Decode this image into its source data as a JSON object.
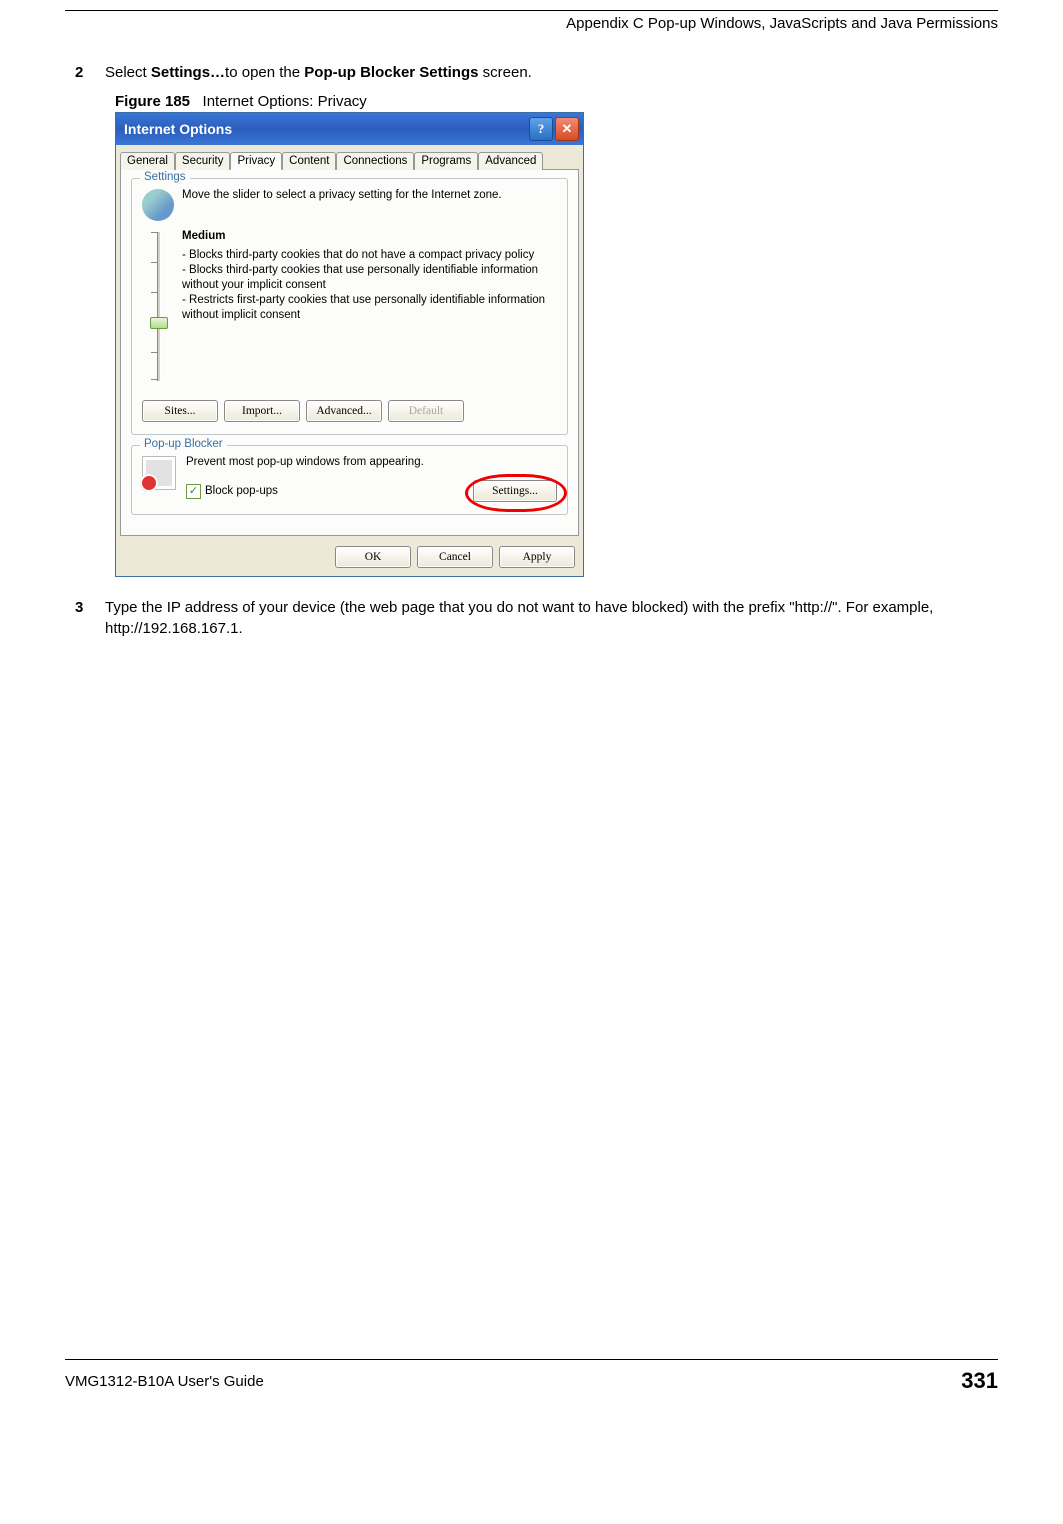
{
  "header": {
    "appendix_title": "Appendix C Pop-up Windows, JavaScripts and Java Permissions"
  },
  "steps": {
    "s2": {
      "num": "2",
      "pre": "Select ",
      "bold1": "Settings…",
      "mid": "to open the ",
      "bold2": "Pop-up Blocker Settings",
      "post": " screen."
    },
    "s3": {
      "num": "3",
      "text": "Type the IP address of your device (the web page that you do not want to have blocked) with the prefix \"http://\". For example, http://192.168.167.1."
    }
  },
  "figure": {
    "num": "Figure 185",
    "caption": "Internet Options: Privacy"
  },
  "dialog": {
    "title": "Internet Options",
    "help": "?",
    "close": "✕",
    "tabs": [
      "General",
      "Security",
      "Privacy",
      "Content",
      "Connections",
      "Programs",
      "Advanced"
    ],
    "active_tab_index": 2,
    "settings": {
      "group": "Settings",
      "desc": "Move the slider to select a privacy setting for the Internet zone.",
      "level": "Medium",
      "bullets": "- Blocks third-party cookies that do not have a compact privacy policy\n- Blocks third-party cookies that use personally identifiable information without your implicit consent\n- Restricts first-party cookies that use personally identifiable information without implicit consent",
      "buttons": {
        "sites": "Sites...",
        "import": "Import...",
        "advanced": "Advanced...",
        "default": "Default"
      }
    },
    "popup": {
      "group": "Pop-up Blocker",
      "desc": "Prevent most pop-up windows from appearing.",
      "checkbox": "Block pop-ups",
      "checked": true,
      "settings_btn": "Settings..."
    },
    "footer": {
      "ok": "OK",
      "cancel": "Cancel",
      "apply": "Apply"
    }
  },
  "footer": {
    "guide": "VMG1312-B10A User's Guide",
    "page": "331"
  }
}
